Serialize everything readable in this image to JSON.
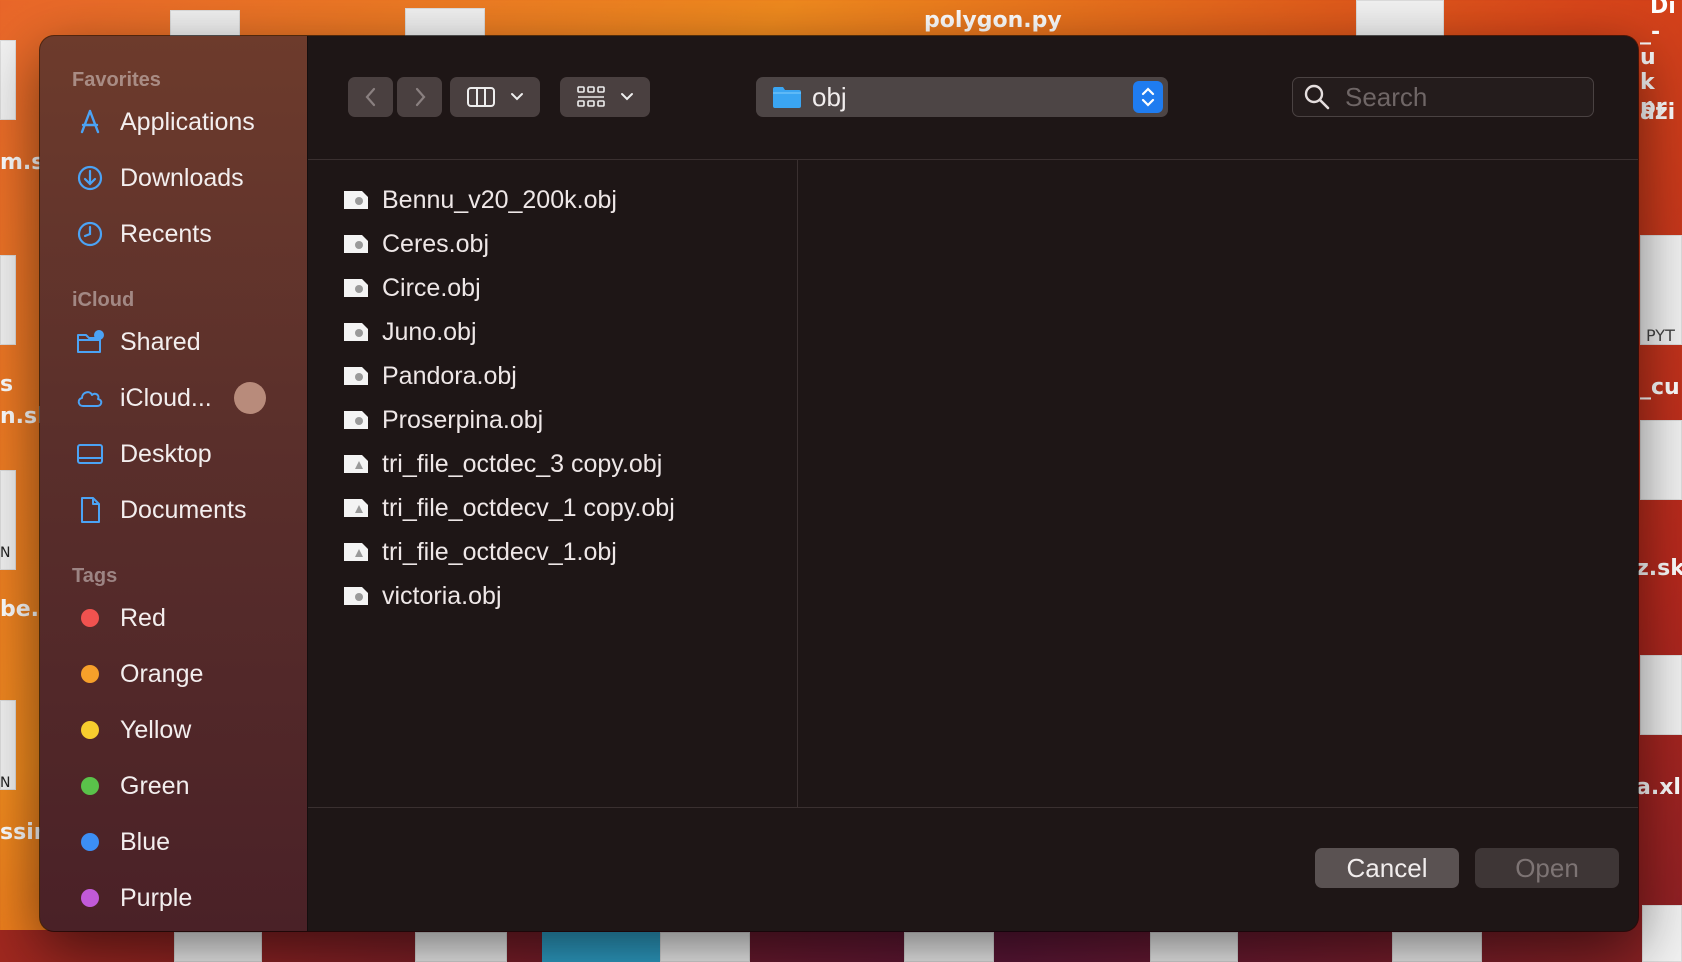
{
  "desktop": {
    "window_title": "polygon.py",
    "left_snippets": [
      "m.s",
      "s",
      "n.sk",
      "N",
      "be.",
      "N",
      "ssir"
    ],
    "right_snippets": [
      "Di",
      "_- u",
      "k pr",
      "ázi",
      "PYT",
      "_cu",
      "z.sk",
      "a.xls"
    ]
  },
  "sidebar": {
    "favorites_title": "Favorites",
    "favorites": [
      {
        "label": "Applications",
        "icon": "applications-icon"
      },
      {
        "label": "Downloads",
        "icon": "downloads-icon"
      },
      {
        "label": "Recents",
        "icon": "recents-icon"
      }
    ],
    "icloud_title": "iCloud",
    "icloud": [
      {
        "label": "Shared",
        "icon": "shared-folder-icon"
      },
      {
        "label": "iCloud...",
        "icon": "cloud-icon"
      },
      {
        "label": "Desktop",
        "icon": "desktop-icon"
      },
      {
        "label": "Documents",
        "icon": "document-icon"
      }
    ],
    "tags_title": "Tags",
    "tags": [
      {
        "label": "Red",
        "color": "#f0524f"
      },
      {
        "label": "Orange",
        "color": "#f6a02a"
      },
      {
        "label": "Yellow",
        "color": "#f7cd2e"
      },
      {
        "label": "Green",
        "color": "#5ac24a"
      },
      {
        "label": "Blue",
        "color": "#3c8ef4"
      },
      {
        "label": "Purple",
        "color": "#c25ad8"
      }
    ]
  },
  "toolbar": {
    "back_icon": "chevron-left-icon",
    "forward_icon": "chevron-right-icon",
    "view_icon": "columns-view-icon",
    "group_icon": "grid-group-icon",
    "path_label": "obj",
    "search_placeholder": "Search"
  },
  "files": [
    "Bennu_v20_200k.obj",
    "Ceres.obj",
    "Circe.obj",
    "Juno.obj",
    "Pandora.obj",
    "Proserpina.obj",
    "tri_file_octdec_3 copy.obj",
    "tri_file_octdecv_1 copy.obj",
    "tri_file_octdecv_1.obj",
    "victoria.obj"
  ],
  "footer": {
    "cancel_label": "Cancel",
    "open_label": "Open"
  },
  "colors": {
    "accent": "#1f7cf0",
    "sidebar_icon": "#4ba3f5"
  }
}
